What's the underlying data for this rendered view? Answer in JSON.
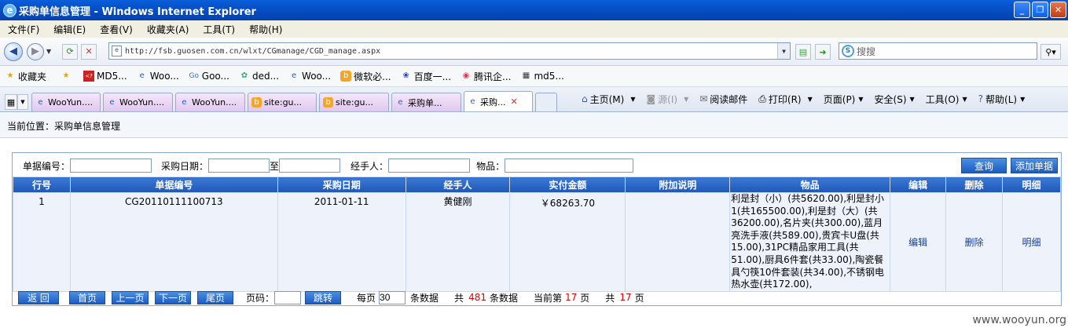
{
  "window": {
    "title": "采购单信息管理 - Windows Internet Explorer",
    "min": "_",
    "max": "❐",
    "close": "✕"
  },
  "menu": [
    "文件(F)",
    "编辑(E)",
    "查看(V)",
    "收藏夹(A)",
    "工具(T)",
    "帮助(H)"
  ],
  "address": {
    "url": "http://fsb.guosen.com.cn/wlxt/CGmanage/CGD_manage.aspx"
  },
  "search": {
    "placeholder": "搜搜"
  },
  "favorites": {
    "label": "收藏夹",
    "items": [
      "MD5...",
      "Woo...",
      "Goo...",
      "ded...",
      "Woo...",
      "微软必...",
      "百度一...",
      "腾讯企...",
      "md5..."
    ]
  },
  "tabs": [
    "WooYun....",
    "WooYun....",
    "WooYun....",
    "site:gu...",
    "site:gu...",
    "采购单...",
    "采购..."
  ],
  "tools": [
    "主页(M)",
    "源(I)",
    "阅读邮件",
    "打印(R)",
    "页面(P)",
    "安全(S)",
    "工具(O)",
    "帮助(L)"
  ],
  "breadcrumb": "当前位置：采购单信息管理",
  "filters": {
    "doc_no_label": "单据编号：",
    "date_label": "采购日期：",
    "date_to": "至",
    "handler_label": "经手人：",
    "item_label": "物品：",
    "query_btn": "查询",
    "add_btn": "添加单据"
  },
  "table": {
    "headers": [
      "行号",
      "单据编号",
      "采购日期",
      "经手人",
      "实付金额",
      "附加说明",
      "物品",
      "编辑",
      "删除",
      "明细"
    ],
    "rows": [
      {
        "no": "1",
        "doc": "CG20110111100713",
        "date": "2011-01-11",
        "handler": "黄健刚",
        "amount": "￥68263.70",
        "note": "",
        "goods": "利是封（小）(共5620.00),利是封小1(共165500.00),利是封（大）(共36200.00),名片夹(共300.00),蓝月亮洗手液(共589.00),贵宾卡U盘(共15.00),31PC精品家用工具(共51.00),厨具6件套(共33.00),陶瓷餐具勺筷10件套装(共34.00),不锈钢电热水壶(共172.00),",
        "edit": "编辑",
        "del": "删除",
        "detail": "明细"
      }
    ]
  },
  "pager": {
    "back": "返 回",
    "first": "首页",
    "prev": "上一页",
    "next": "下一页",
    "last": "尾页",
    "page_label": "页码：",
    "jump": "跳转",
    "per_page_label": "每页",
    "per_page": "30",
    "per_page_unit": "条数据",
    "total_pre": "共",
    "total": "481",
    "total_unit": "条数据",
    "current_pre": "当前第",
    "current": "17",
    "current_unit": "页",
    "pages_pre": "共",
    "pages": "17",
    "pages_unit": "页"
  },
  "watermark": "www.wooyun.org"
}
